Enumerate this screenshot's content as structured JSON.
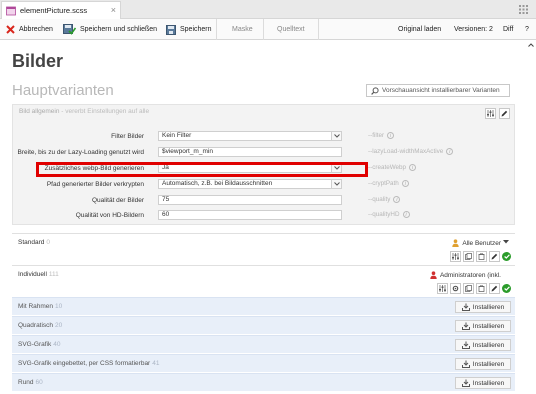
{
  "tab": {
    "title": "elementPicture.scss",
    "close": "×",
    "file_icon": "file-code-icon"
  },
  "toolbar": {
    "cancel": "Abbrechen",
    "save_close": "Speichern und schließen",
    "save": "Speichern",
    "tab_mask": "Maske",
    "tab_source": "Quelltext",
    "reload": "Original laden",
    "versions": "Versionen: 2",
    "diff": "Diff",
    "help": "?"
  },
  "page": {
    "title": "Bilder",
    "section": "Hauptvarianten",
    "search_placeholder": "Vorschauansicht installierbarer Varianten"
  },
  "panel": {
    "header": "Bild allgemein",
    "header_sub": "- vererbt Einstellungen auf alle"
  },
  "settings": [
    {
      "label": "Filter Bilder",
      "value": "Kein Filter",
      "type": "select",
      "prop": "--filter"
    },
    {
      "label": "Breite, bis zu der Lazy-Loading genutzt wird",
      "value": "$viewport_m_min",
      "type": "text",
      "prop": "--lazyLoad-widthMaxActive"
    },
    {
      "label": "Zusätzliches webp-Bild generieren",
      "value": "Ja",
      "type": "select",
      "prop": "--createWebp"
    },
    {
      "label": "Pfad generierter Bilder verkrypten",
      "value": "Automatisch, z.B. bei Bildausschnitten",
      "type": "select",
      "prop": "--cryptPath"
    },
    {
      "label": "Qualität der Bilder",
      "value": "75",
      "type": "text",
      "prop": "--quality"
    },
    {
      "label": "Qualität von HD-Bildern",
      "value": "60",
      "type": "text",
      "prop": "--qualityHD"
    }
  ],
  "info_glyph": "i",
  "variants": [
    {
      "name": "Standard",
      "count": "0",
      "users": "Alle Benutzer"
    },
    {
      "name": "Individuell",
      "count": "111",
      "users": "Administratoren (inkl."
    }
  ],
  "installables": [
    {
      "name": "Mit Rahmen",
      "count": "10"
    },
    {
      "name": "Quadratisch",
      "count": "20"
    },
    {
      "name": "SVG-Grafik",
      "count": "40"
    },
    {
      "name": "SVG-Grafik eingebettet, per CSS formatierbar",
      "count": "41"
    },
    {
      "name": "Rund",
      "count": "60"
    }
  ],
  "install_label": "Installieren",
  "colors": {
    "highlight": "#e00000",
    "ok": "#2b9c2b",
    "install_row": "#e8eff9",
    "cancel": "#d9261c"
  }
}
